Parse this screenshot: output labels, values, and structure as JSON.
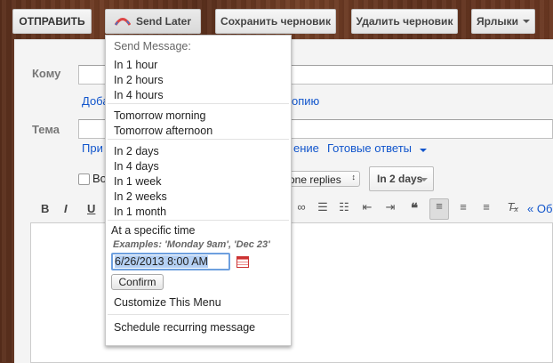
{
  "toolbar": {
    "send_label": "ОТПРАВИТЬ",
    "send_later_label": "Send Later",
    "save_draft_label": "Сохранить черновик",
    "delete_draft_label": "Удалить черновик",
    "labels_label": "Ярлыки"
  },
  "compose": {
    "to_label": "Кому",
    "to_link_left": "Доба",
    "to_link_right": "опию",
    "subject_label": "Тема",
    "subject_link_left": "При",
    "subject_link_mid": "ение",
    "canned_responses": "Готовые ответы",
    "checkbox_label": "Во",
    "canned_select": "one replies",
    "followup_select": "In 2 days",
    "format_bold": "B",
    "format_italic": "I",
    "format_underline": "U",
    "quote_link": "« Об"
  },
  "menu": {
    "header": "Send Message:",
    "group1": [
      "In 1 hour",
      "In 2 hours",
      "In 4 hours"
    ],
    "group2": [
      "Tomorrow morning",
      "Tomorrow afternoon"
    ],
    "group3": [
      "In 2 days",
      "In 4 days",
      "In 1 week",
      "In 2 weeks",
      "In 1 month"
    ],
    "specific_time_label": "At a specific time",
    "examples": "Examples: 'Monday 9am', 'Dec 23'",
    "datetime_value": "6/26/2013 8:00 AM",
    "confirm_label": "Confirm",
    "customize_label": "Customize This Menu",
    "recurring_label": "Schedule recurring message"
  },
  "colors": {
    "link": "#1155cc",
    "wood": "#6b3822"
  }
}
